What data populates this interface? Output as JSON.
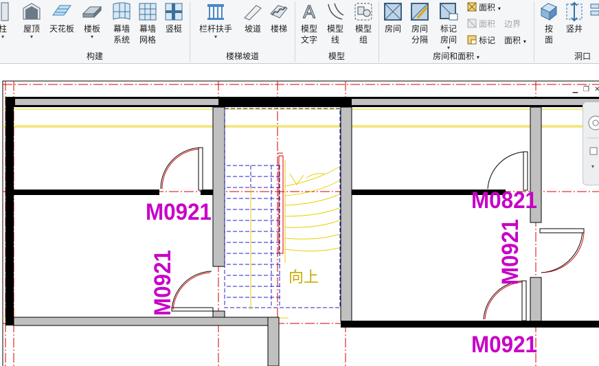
{
  "ribbon": {
    "buttons": [
      {
        "id": "column",
        "label": "柱",
        "has_dropdown": true
      },
      {
        "id": "roof",
        "label": "屋顶",
        "has_dropdown": true
      },
      {
        "id": "ceiling",
        "label": "天花板",
        "has_dropdown": false
      },
      {
        "id": "floor",
        "label": "楼板",
        "has_dropdown": true
      },
      {
        "id": "curtain_system",
        "label": "幕墙\n系统",
        "has_dropdown": false
      },
      {
        "id": "curtain_grid",
        "label": "幕墙\n网格",
        "has_dropdown": false
      },
      {
        "id": "mullion",
        "label": "竖梃",
        "has_dropdown": false
      },
      {
        "id": "railing",
        "label": "栏杆扶手",
        "has_dropdown": true
      },
      {
        "id": "ramp",
        "label": "坡道",
        "has_dropdown": false
      },
      {
        "id": "stair",
        "label": "楼梯",
        "has_dropdown": false
      },
      {
        "id": "model_text",
        "label": "模型\n文字",
        "has_dropdown": false
      },
      {
        "id": "model_line",
        "label": "模型\n线",
        "has_dropdown": false
      },
      {
        "id": "model_group",
        "label": "模型\n组",
        "has_dropdown": true
      },
      {
        "id": "room",
        "label": "房间",
        "has_dropdown": false
      },
      {
        "id": "room_separator",
        "label": "房间\n分隔",
        "has_dropdown": false
      },
      {
        "id": "tag_room",
        "label": "标记\n房间",
        "has_dropdown": true
      },
      {
        "id": "by_face",
        "label": "按\n面",
        "has_dropdown": false
      },
      {
        "id": "shaft",
        "label": "竖井",
        "has_dropdown": false
      }
    ],
    "small_buttons": {
      "area": "面积",
      "area_disabled": "面积",
      "area_boundary": "边界",
      "tag": "标记",
      "tag_area": "面积"
    },
    "panels": {
      "build": "构建",
      "circulation": "楼梯坡道",
      "model": "模型",
      "room_area": "房间和面积",
      "opening": "洞口"
    }
  },
  "canvas": {
    "window_controls": {
      "minimize": "▁",
      "restore": "❐",
      "close": "✕"
    },
    "stair_label": "向上",
    "door_tags": {
      "left_upper": "M0921",
      "left_vertical": "M0921",
      "right_upper": "M0821",
      "right_vertical": "M0921",
      "right_bottom": "M0921"
    },
    "colors": {
      "tag": "#c800c8",
      "wall": "#000000",
      "wall_fill": "#c0c0c0",
      "grid_line": "#d40000",
      "reference_line": "#e6d200",
      "stair_lines": "#2020c8"
    }
  }
}
